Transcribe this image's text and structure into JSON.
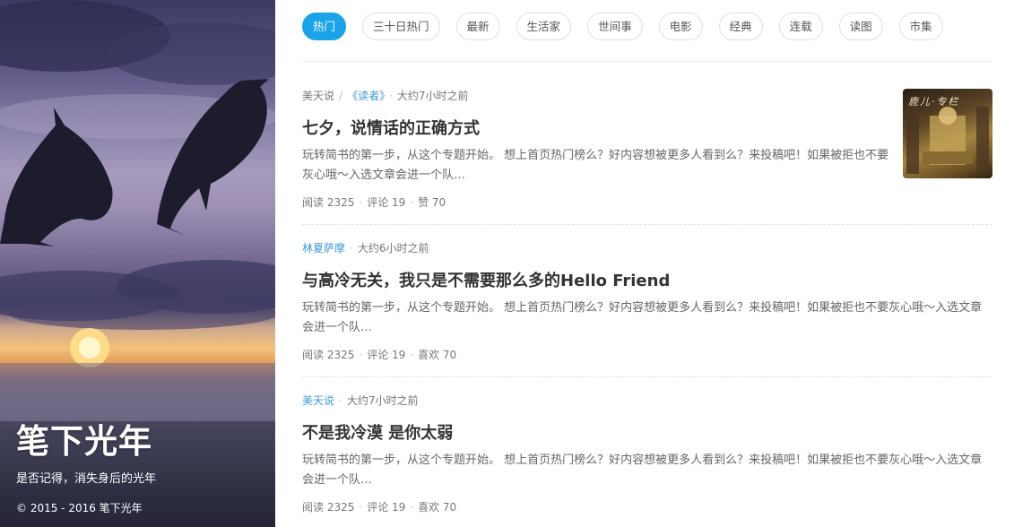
{
  "hero": {
    "title": "笔下光年",
    "subtitle": "是否记得，消失身后的光年",
    "copyright": "© 2015 - 2016 笔下光年"
  },
  "tabs": [
    {
      "label": "热门",
      "active": true
    },
    {
      "label": "三十日热门",
      "active": false
    },
    {
      "label": "最新",
      "active": false
    },
    {
      "label": "生活家",
      "active": false
    },
    {
      "label": "世间事",
      "active": false
    },
    {
      "label": "电影",
      "active": false
    },
    {
      "label": "经典",
      "active": false
    },
    {
      "label": "连载",
      "active": false
    },
    {
      "label": "读图",
      "active": false
    },
    {
      "label": "市集",
      "active": false
    }
  ],
  "articles": [
    {
      "author": "美天说",
      "collection": "《读者》",
      "time": "大约7小时之前",
      "title": "七夕，说情话的正确方式",
      "excerpt": "玩转简书的第一步，从这个专题开始。 想上首页热门榜么？好内容想被更多人看到么？来投稿吧！如果被拒也不要灰心哦～入选文章会进一个队…",
      "stats": {
        "read": "阅读 2325",
        "comment": "评论 19",
        "like": "赞 70"
      },
      "thumb_caption": "鹿儿·专栏"
    },
    {
      "author": "林夏萨摩",
      "time": "大约6小时之前",
      "title": "与高冷无关，我只是不需要那么多的Hello Friend",
      "excerpt": "玩转简书的第一步，从这个专题开始。 想上首页热门榜么？好内容想被更多人看到么？来投稿吧！如果被拒也不要灰心哦～入选文章会进一个队…",
      "stats": {
        "read": "阅读 2325",
        "comment": "评论 19",
        "like": "喜欢 70"
      }
    },
    {
      "author": "美天说",
      "time": "大约7小时之前",
      "title": "不是我冷漠 是你太弱",
      "excerpt": "玩转简书的第一步，从这个专题开始。 想上首页热门榜么？好内容想被更多人看到么？来投稿吧！如果被拒也不要灰心哦～入选文章会进一个队…",
      "stats": {
        "read": "阅读 2325",
        "comment": "评论 19",
        "like": "喜欢 70"
      }
    }
  ],
  "colors": {
    "accent": "#1aa3e8",
    "link": "#3a9ad9"
  }
}
